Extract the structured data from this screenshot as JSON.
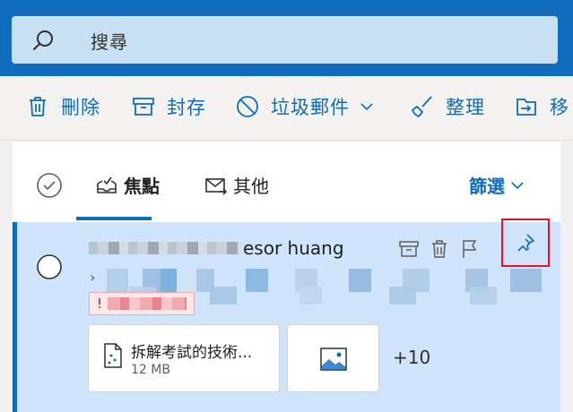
{
  "search": {
    "placeholder": "搜尋"
  },
  "toolbar": {
    "delete_label": "刪除",
    "archive_label": "封存",
    "junk_label": "垃圾郵件",
    "sweep_label": "整理",
    "move_label": "移"
  },
  "pivot": {
    "focused_label": "焦點",
    "other_label": "其他",
    "filter_label": "篩選"
  },
  "message": {
    "sender_visible": "esor huang",
    "attachment": {
      "name": "拆解考試的技術...",
      "size": "12 MB"
    },
    "more_attachments": "+10",
    "importance_mark": "!"
  },
  "colors": {
    "brand": "#0f6cbd",
    "search_bg": "#c7e0f4",
    "selected_row": "#cfe4fa",
    "highlight_box": "#e81123"
  },
  "icons": {
    "search": "search-icon",
    "delete": "trash-icon",
    "archive": "archive-icon",
    "junk": "block-icon",
    "sweep": "broom-icon",
    "move": "move-to-folder-icon",
    "focused": "inbox-tray-icon",
    "other": "mail-arrow-icon",
    "pin": "pin-icon",
    "flag": "flag-icon",
    "file": "file-icon",
    "image": "image-icon"
  }
}
